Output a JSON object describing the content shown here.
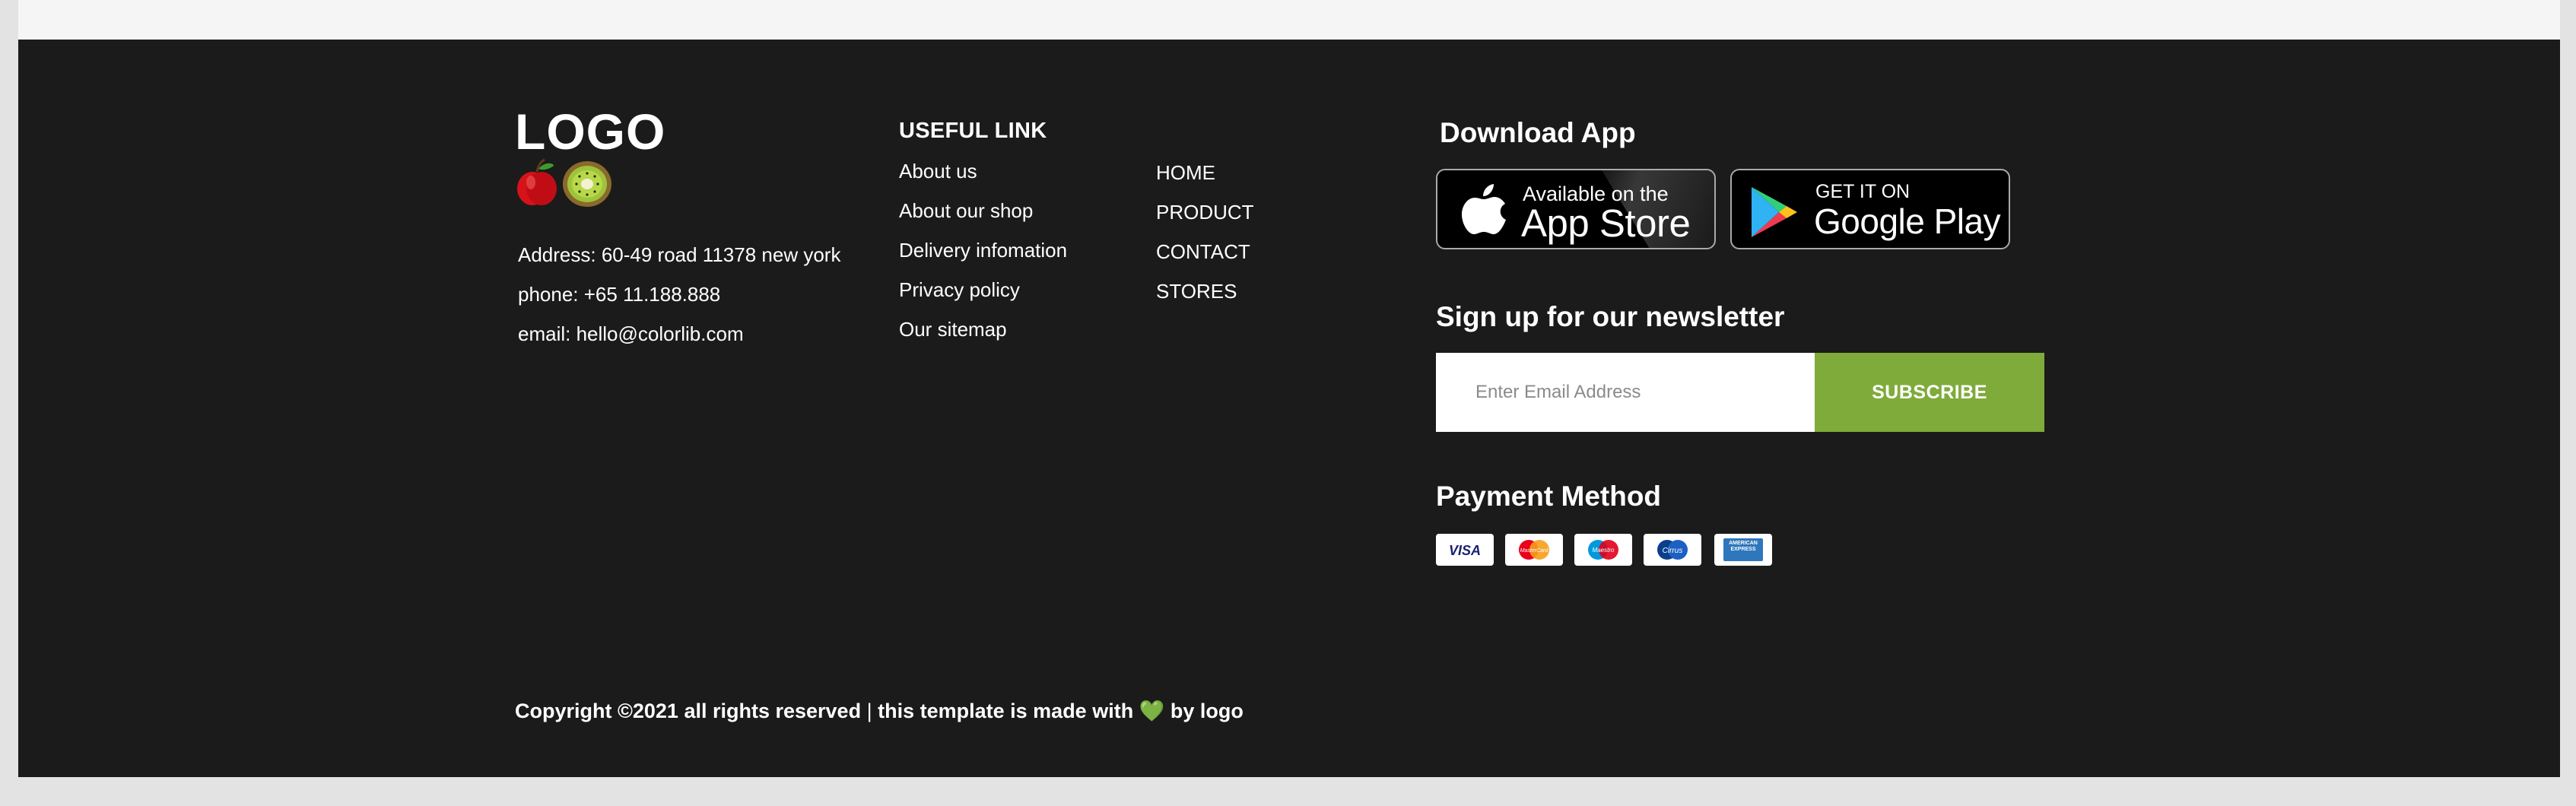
{
  "footer": {
    "logo_text": "LOGO",
    "contact": {
      "address": "Address: 60-49 road 11378 new york",
      "phone": "phone: +65 11.188.888",
      "email": "email: hello@colorlib.com"
    },
    "useful_link": {
      "heading": "USEFUL LINK",
      "left_links": [
        "About us",
        "About our shop",
        "Delivery infomation",
        "Privacy policy",
        "Our sitemap"
      ],
      "right_links": [
        "HOME",
        "PRODUCT",
        "CONTACT",
        "STORES"
      ]
    },
    "download_app": {
      "title": "Download App",
      "app_store": {
        "small": "Available on the",
        "big": "App Store"
      },
      "google_play": {
        "small": "GET IT ON",
        "big": "Google Play"
      }
    },
    "newsletter": {
      "title": "Sign up for our newsletter",
      "placeholder": "Enter Email Address",
      "button": "SUBSCRIBE"
    },
    "payment": {
      "title": "Payment Method",
      "cards": [
        {
          "icon": "visa-card-icon",
          "label": "VISA"
        },
        {
          "icon": "mastercard-icon",
          "label": "MasterCard"
        },
        {
          "icon": "maestro-card-icon",
          "label": "Maestro"
        },
        {
          "icon": "cirrus-card-icon",
          "label": "Cirrus"
        },
        {
          "icon": "amex-card-icon",
          "label": "AMERICAN EXPRESS"
        }
      ]
    },
    "copyright": {
      "prefix": "Copyright ©2021 all rights reserved",
      "separator": "|",
      "middle": "this template is made with",
      "heart": "💚",
      "by": "by",
      "brand": "logo"
    }
  },
  "colors": {
    "footer_bg": "#1b1b1b",
    "accent_green": "#7fab3a",
    "text": "#ffffff"
  }
}
